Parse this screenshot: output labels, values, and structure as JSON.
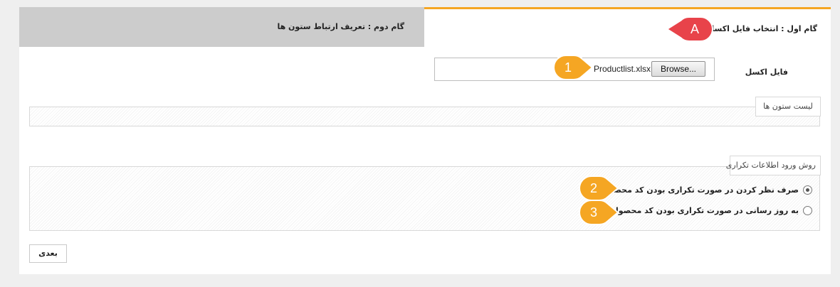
{
  "tabs": {
    "step1_label": "گام اول : انتخاب فایل اکسل",
    "step2_label": "گام دوم : تعریف ارتباط ستون ها"
  },
  "file": {
    "label": "فایل اکسل",
    "browse_label": "Browse...",
    "file_name": "Productlist.xlsx"
  },
  "columns_section": {
    "legend": "لیست ستون ها"
  },
  "duplicate_section": {
    "legend": "روش ورود اطلاعات تکراری",
    "options": [
      {
        "label": "صرف نظر کردن در صورت تکراری بودن کد محصول",
        "checked": true
      },
      {
        "label": "به روز رسانی در صورت تکراری بودن کد محصول",
        "checked": false
      }
    ]
  },
  "actions": {
    "next_label": "بعدی"
  },
  "callouts": [
    {
      "text": "A",
      "color": "#e8434a"
    },
    {
      "text": "1",
      "color": "#f5a623"
    },
    {
      "text": "2",
      "color": "#f5a623"
    },
    {
      "text": "3",
      "color": "#f5a623"
    }
  ]
}
